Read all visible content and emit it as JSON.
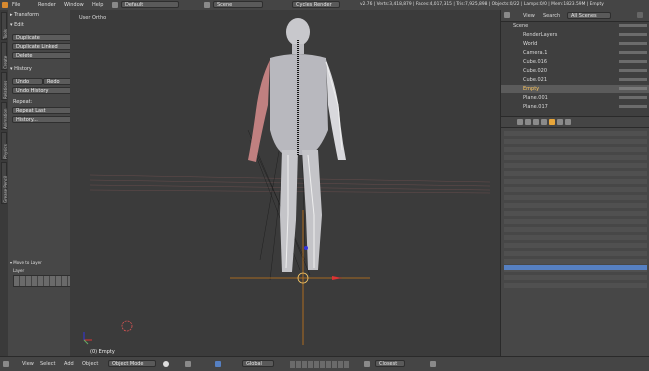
{
  "topbar": {
    "menus": [
      "File",
      "Render",
      "Window",
      "Help"
    ],
    "layout": "Default",
    "scene": "Scene",
    "engine": "Cycles Render",
    "stats": "v2.76 | Verts:3,418,879 | Faces:4,017,315 | Tris:7,925,898 | Objects:0/22 | Lamps:0/0 | Mem:1823.59M | Empty"
  },
  "tabs": [
    "Tools",
    "Create",
    "Relations",
    "Animation",
    "Physics",
    "Grease Pencil"
  ],
  "toolshelf": {
    "transform": "▸ Transform",
    "edit": "▾ Edit",
    "duplicate": "Duplicate",
    "duplicate_linked": "Duplicate Linked",
    "delete": "Delete",
    "history": "▾ History",
    "undo": "Undo",
    "redo": "Redo",
    "undo_history": "Undo History",
    "repeat": "Repeat:",
    "repeat_last": "Repeat Last",
    "history_btn": "History...",
    "move_to_layer": "▾ Move to Layer",
    "layer": "Layer"
  },
  "viewport": {
    "label": "User Ortho",
    "object_label": "(0) Empty"
  },
  "outliner": {
    "menus": [
      "View",
      "Search"
    ],
    "filter": "All Scenes",
    "items": [
      {
        "name": "Scene"
      },
      {
        "name": "RenderLayers"
      },
      {
        "name": "World"
      },
      {
        "name": "Camera.1"
      },
      {
        "name": "Cube.016"
      },
      {
        "name": "Cube.020"
      },
      {
        "name": "Cube.021"
      },
      {
        "name": "Empty"
      },
      {
        "name": "Plane.001"
      },
      {
        "name": "Plane.017"
      }
    ]
  },
  "bottombar": {
    "menus": [
      "View",
      "Select",
      "Add",
      "Object"
    ],
    "mode": "Object Mode",
    "pivot": "Global",
    "snap": "Closest"
  },
  "colors": {
    "accent": "#5680c2",
    "selected": "#e8a63a",
    "x_axis": "#d33",
    "y_axis": "#6a6",
    "z_axis": "#33d"
  }
}
